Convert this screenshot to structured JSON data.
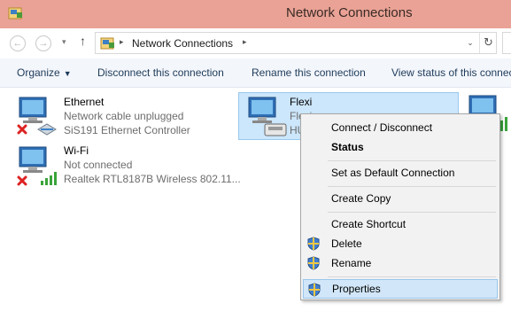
{
  "window": {
    "title": "Network Connections"
  },
  "address": {
    "path_label": "Network Connections",
    "back_glyph": "←",
    "forward_glyph": "→",
    "recent_glyph": "▾",
    "up_glyph": "↑",
    "sep_glyph": "▸",
    "dropdown_glyph": "⌄",
    "refresh_glyph": "↻"
  },
  "toolbar": {
    "organize": "Organize",
    "organize_caret": "▼",
    "disconnect": "Disconnect this connection",
    "rename": "Rename this connection",
    "view_status": "View status of this connec"
  },
  "connections": [
    {
      "name": "Ethernet",
      "status": "Network cable unplugged",
      "device": "SiS191 Ethernet Controller",
      "icon": "ethernet-adapter-icon",
      "error": true
    },
    {
      "name": "Wi-Fi",
      "status": "Not connected",
      "device": "Realtek RTL8187B Wireless 802.11...",
      "icon": "wifi-adapter-icon",
      "error": true
    },
    {
      "name": "Flexi",
      "status": "Flexi",
      "device": "HU",
      "icon": "dialup-modem-icon",
      "selected": true
    }
  ],
  "context_menu": {
    "items": [
      {
        "label": "Connect / Disconnect",
        "bold": false,
        "shield": false
      },
      {
        "label": "Status",
        "bold": true,
        "shield": false
      },
      {
        "label": "Set as Default Connection",
        "bold": false,
        "shield": false
      },
      {
        "label": "Create Copy",
        "bold": false,
        "shield": false
      },
      {
        "label": "Create Shortcut",
        "bold": false,
        "shield": false
      },
      {
        "label": "Delete",
        "bold": false,
        "shield": true
      },
      {
        "label": "Rename",
        "bold": false,
        "shield": true
      },
      {
        "label": "Properties",
        "bold": false,
        "shield": true,
        "highlighted": true
      }
    ]
  },
  "colors": {
    "titlebar": "#e9a295",
    "selection": "#cce6fb",
    "menu_highlight": "#d1e6f8",
    "link_text": "#1e3b5a"
  }
}
